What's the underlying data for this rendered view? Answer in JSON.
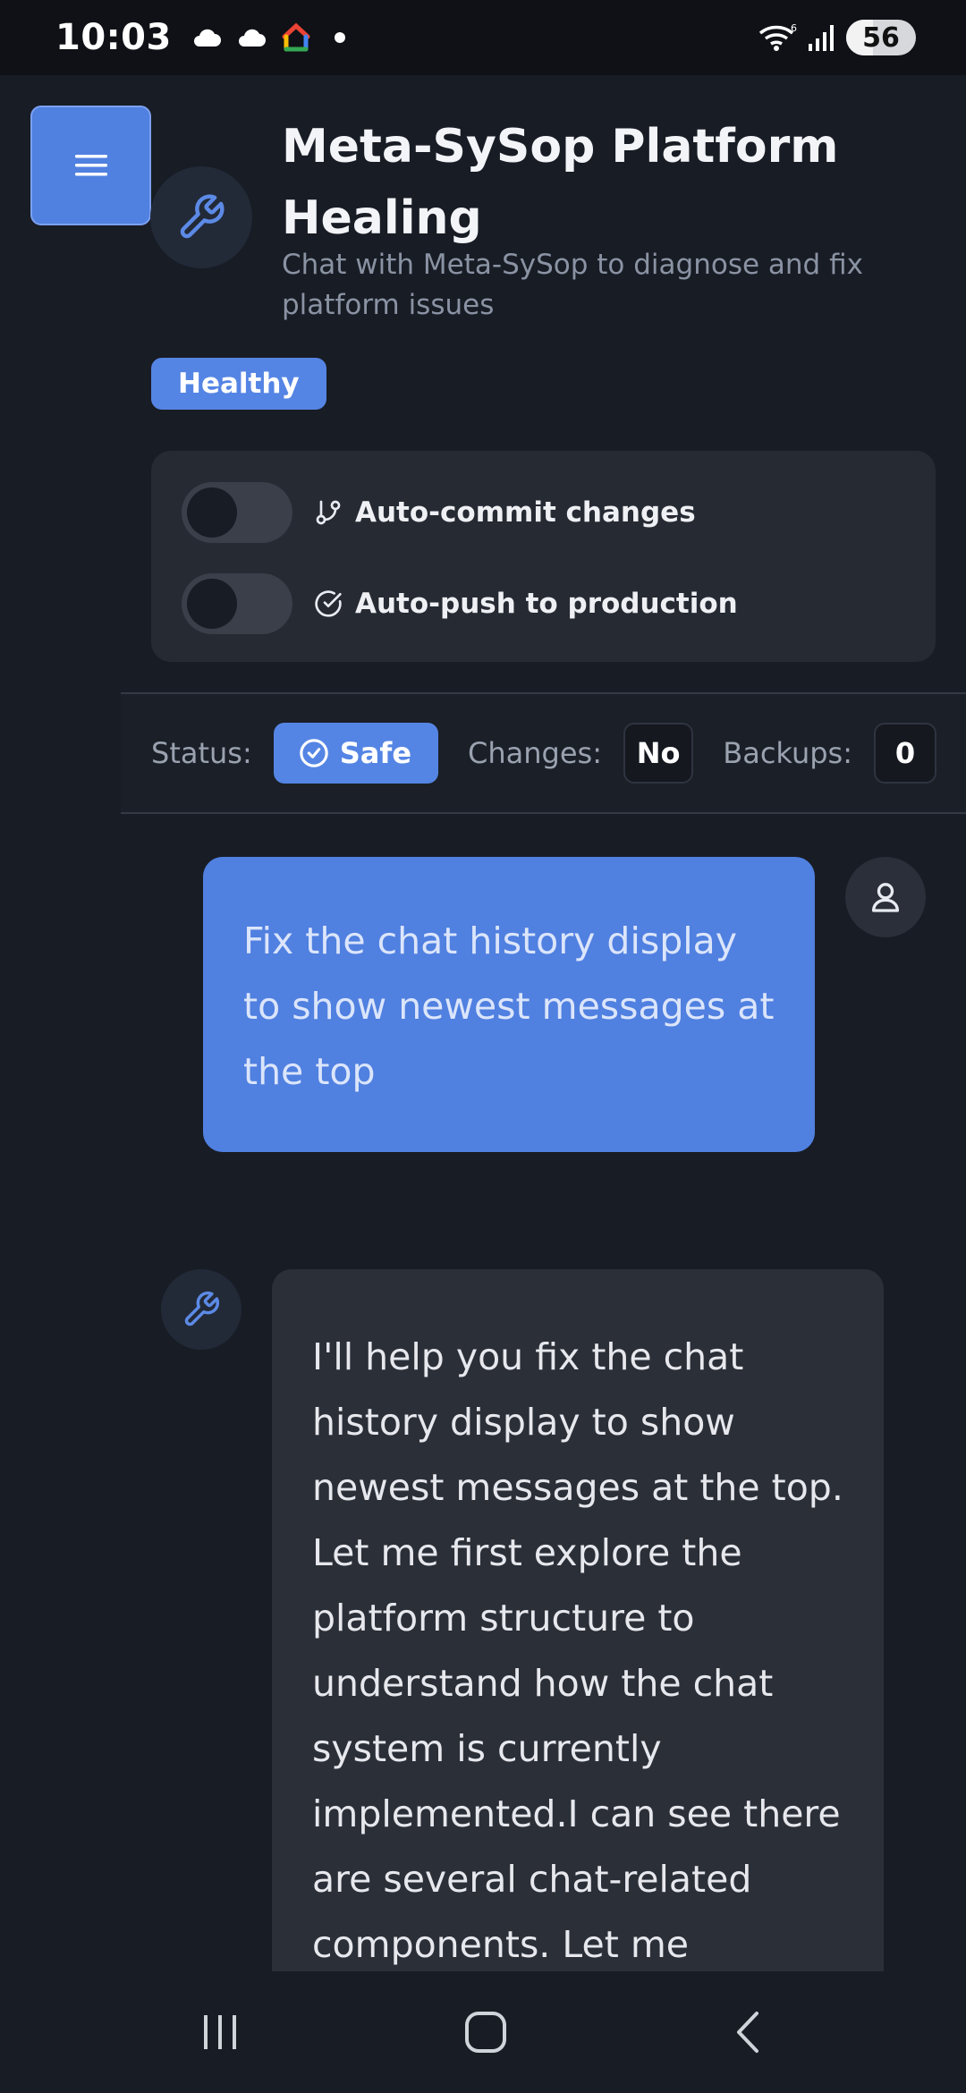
{
  "status_bar": {
    "time": "10:03",
    "battery": "56",
    "icons": [
      "cloud-icon",
      "cloud-icon",
      "home-app-icon",
      "notification-dot-icon",
      "wifi-icon",
      "signal-icon",
      "battery-icon"
    ]
  },
  "header": {
    "title": "Meta-SySop Platform Healing",
    "subtitle": "Chat with Meta-SySop to diagnose and fix platform issues",
    "health_badge": "Healthy"
  },
  "settings": {
    "auto_commit_label": "Auto-commit changes",
    "auto_commit_on": false,
    "auto_push_label": "Auto-push to production",
    "auto_push_on": false
  },
  "status": {
    "status_label": "Status:",
    "status_value": "Safe",
    "changes_label": "Changes:",
    "changes_value": "No",
    "backups_label": "Backups:",
    "backups_value": "0"
  },
  "messages": [
    {
      "role": "user",
      "text": "Fix the chat history display to show newest messages at the top"
    },
    {
      "role": "assistant",
      "text": "I'll help you fix the chat history display to show newest messages at the top. Let me first explore the platform structure to understand how the chat system is currently implemented.I can see there are several chat-related components. Let me examine the main chat components to"
    }
  ],
  "colors": {
    "accent": "#5080e0",
    "background": "#181c24",
    "card": "#262a33",
    "assistant_bubble": "#2b2f38"
  }
}
